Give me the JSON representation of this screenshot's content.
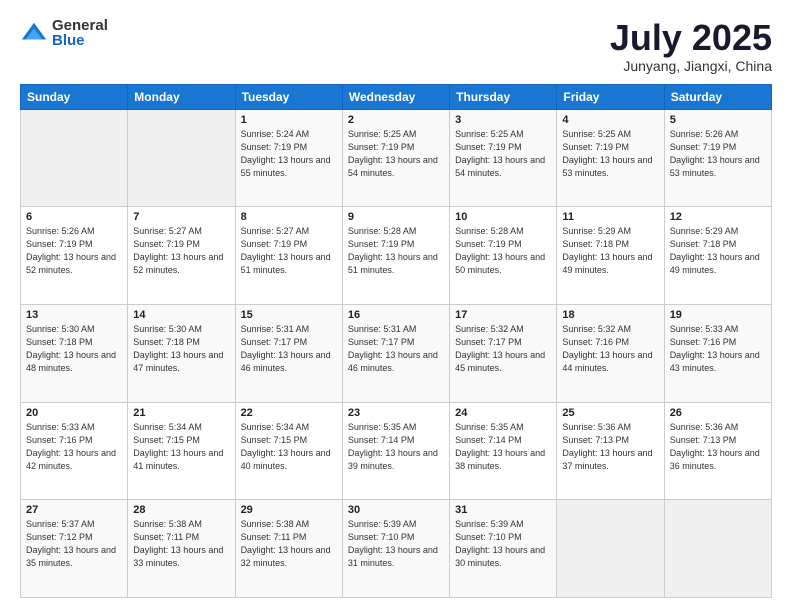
{
  "logo": {
    "general": "General",
    "blue": "Blue"
  },
  "header": {
    "title": "July 2025",
    "subtitle": "Junyang, Jiangxi, China"
  },
  "weekdays": [
    "Sunday",
    "Monday",
    "Tuesday",
    "Wednesday",
    "Thursday",
    "Friday",
    "Saturday"
  ],
  "weeks": [
    [
      {
        "day": "",
        "info": ""
      },
      {
        "day": "",
        "info": ""
      },
      {
        "day": "1",
        "info": "Sunrise: 5:24 AM\nSunset: 7:19 PM\nDaylight: 13 hours and 55 minutes."
      },
      {
        "day": "2",
        "info": "Sunrise: 5:25 AM\nSunset: 7:19 PM\nDaylight: 13 hours and 54 minutes."
      },
      {
        "day": "3",
        "info": "Sunrise: 5:25 AM\nSunset: 7:19 PM\nDaylight: 13 hours and 54 minutes."
      },
      {
        "day": "4",
        "info": "Sunrise: 5:25 AM\nSunset: 7:19 PM\nDaylight: 13 hours and 53 minutes."
      },
      {
        "day": "5",
        "info": "Sunrise: 5:26 AM\nSunset: 7:19 PM\nDaylight: 13 hours and 53 minutes."
      }
    ],
    [
      {
        "day": "6",
        "info": "Sunrise: 5:26 AM\nSunset: 7:19 PM\nDaylight: 13 hours and 52 minutes."
      },
      {
        "day": "7",
        "info": "Sunrise: 5:27 AM\nSunset: 7:19 PM\nDaylight: 13 hours and 52 minutes."
      },
      {
        "day": "8",
        "info": "Sunrise: 5:27 AM\nSunset: 7:19 PM\nDaylight: 13 hours and 51 minutes."
      },
      {
        "day": "9",
        "info": "Sunrise: 5:28 AM\nSunset: 7:19 PM\nDaylight: 13 hours and 51 minutes."
      },
      {
        "day": "10",
        "info": "Sunrise: 5:28 AM\nSunset: 7:19 PM\nDaylight: 13 hours and 50 minutes."
      },
      {
        "day": "11",
        "info": "Sunrise: 5:29 AM\nSunset: 7:18 PM\nDaylight: 13 hours and 49 minutes."
      },
      {
        "day": "12",
        "info": "Sunrise: 5:29 AM\nSunset: 7:18 PM\nDaylight: 13 hours and 49 minutes."
      }
    ],
    [
      {
        "day": "13",
        "info": "Sunrise: 5:30 AM\nSunset: 7:18 PM\nDaylight: 13 hours and 48 minutes."
      },
      {
        "day": "14",
        "info": "Sunrise: 5:30 AM\nSunset: 7:18 PM\nDaylight: 13 hours and 47 minutes."
      },
      {
        "day": "15",
        "info": "Sunrise: 5:31 AM\nSunset: 7:17 PM\nDaylight: 13 hours and 46 minutes."
      },
      {
        "day": "16",
        "info": "Sunrise: 5:31 AM\nSunset: 7:17 PM\nDaylight: 13 hours and 46 minutes."
      },
      {
        "day": "17",
        "info": "Sunrise: 5:32 AM\nSunset: 7:17 PM\nDaylight: 13 hours and 45 minutes."
      },
      {
        "day": "18",
        "info": "Sunrise: 5:32 AM\nSunset: 7:16 PM\nDaylight: 13 hours and 44 minutes."
      },
      {
        "day": "19",
        "info": "Sunrise: 5:33 AM\nSunset: 7:16 PM\nDaylight: 13 hours and 43 minutes."
      }
    ],
    [
      {
        "day": "20",
        "info": "Sunrise: 5:33 AM\nSunset: 7:16 PM\nDaylight: 13 hours and 42 minutes."
      },
      {
        "day": "21",
        "info": "Sunrise: 5:34 AM\nSunset: 7:15 PM\nDaylight: 13 hours and 41 minutes."
      },
      {
        "day": "22",
        "info": "Sunrise: 5:34 AM\nSunset: 7:15 PM\nDaylight: 13 hours and 40 minutes."
      },
      {
        "day": "23",
        "info": "Sunrise: 5:35 AM\nSunset: 7:14 PM\nDaylight: 13 hours and 39 minutes."
      },
      {
        "day": "24",
        "info": "Sunrise: 5:35 AM\nSunset: 7:14 PM\nDaylight: 13 hours and 38 minutes."
      },
      {
        "day": "25",
        "info": "Sunrise: 5:36 AM\nSunset: 7:13 PM\nDaylight: 13 hours and 37 minutes."
      },
      {
        "day": "26",
        "info": "Sunrise: 5:36 AM\nSunset: 7:13 PM\nDaylight: 13 hours and 36 minutes."
      }
    ],
    [
      {
        "day": "27",
        "info": "Sunrise: 5:37 AM\nSunset: 7:12 PM\nDaylight: 13 hours and 35 minutes."
      },
      {
        "day": "28",
        "info": "Sunrise: 5:38 AM\nSunset: 7:11 PM\nDaylight: 13 hours and 33 minutes."
      },
      {
        "day": "29",
        "info": "Sunrise: 5:38 AM\nSunset: 7:11 PM\nDaylight: 13 hours and 32 minutes."
      },
      {
        "day": "30",
        "info": "Sunrise: 5:39 AM\nSunset: 7:10 PM\nDaylight: 13 hours and 31 minutes."
      },
      {
        "day": "31",
        "info": "Sunrise: 5:39 AM\nSunset: 7:10 PM\nDaylight: 13 hours and 30 minutes."
      },
      {
        "day": "",
        "info": ""
      },
      {
        "day": "",
        "info": ""
      }
    ]
  ]
}
